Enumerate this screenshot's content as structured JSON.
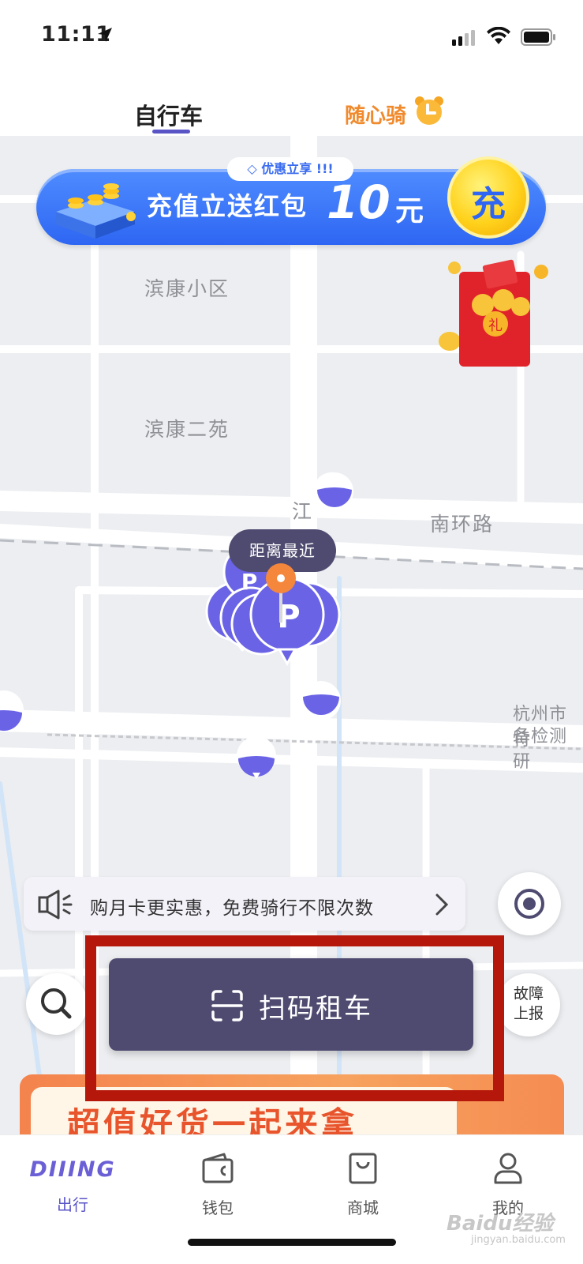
{
  "status_bar": {
    "time": "11:11"
  },
  "tabs": {
    "bike": "自行车",
    "ride": "随心骑"
  },
  "promo": {
    "tag": "优惠立享 !!!",
    "text": "充值立送红包",
    "amount": "10",
    "unit": "元",
    "coin": "充"
  },
  "red_packet": {
    "label": "礼"
  },
  "map": {
    "labels": {
      "binkang_xiaoqu": "滨康小区",
      "binkang_eryuan": "滨康二苑",
      "nanhuan_road": "南环路",
      "jiang": "江",
      "hangzhou_1": "杭州市特",
      "hangzhou_2": "备检测研"
    },
    "nearest_tip": "距离最近",
    "parking_letter": "P"
  },
  "notice": {
    "text": "购月卡更实惠，免费骑行不限次数"
  },
  "report_button": {
    "line1": "故障",
    "line2": "上报"
  },
  "scan_button": {
    "label": "扫码租车"
  },
  "bottom_banner": {
    "text": "超值好货一起来拿"
  },
  "bottom_nav": {
    "logo": "DIIING",
    "items": [
      "出行",
      "钱包",
      "商城",
      "我的"
    ]
  },
  "watermark": {
    "main": "Baidu经验",
    "sub": "jingyan.baidu.com"
  },
  "colors": {
    "brand": "#5a55c7",
    "scan_button": "#4f4b70",
    "highlight": "#b5170a",
    "ride_tab": "#f08a2c",
    "promo": "#2e66f3"
  }
}
